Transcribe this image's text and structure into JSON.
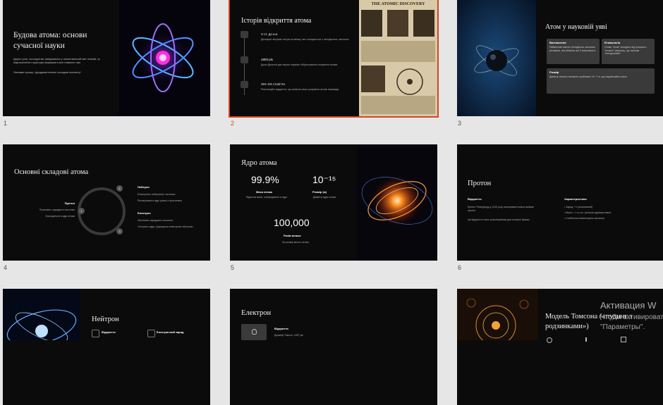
{
  "slides": [
    {
      "number": "1",
      "title": "Будова атома: основи сучасної науки",
      "body1": "Дорогі учні, сьогодні ми зануримося у захоплюючий світ атомів, ці мікроскопічні структури формують все навколо нас.",
      "body2": "Ласкаво прошу: фундаментальні складові всесвіту!"
    },
    {
      "number": "2",
      "title": "Історія відкриття атома",
      "poster_title": "THE ATOMIC DISCOVERY",
      "items": [
        {
          "label": "V ст. до н.е.",
          "text": "Демокрит висуває теорію атомізму: все складається з неподільних частинок."
        },
        {
          "label": "1803 рік",
          "text": "Джон Дальтон дає перше наукове обґрунтування існування атомів."
        },
        {
          "label": "XIX–XX століття",
          "text": "Революційні відкриття, що змінили наше розуміння атома назавжди."
        }
      ]
    },
    {
      "number": "3",
      "title": "Атом у науковій уяві",
      "cards": [
        {
          "h": "Визначення",
          "t": "Найменша хімічно неподільна частинка речовини, яка зберігає всі її властивості."
        },
        {
          "h": "Етимологія",
          "t": "Слово \"атом\" походить від грецького \"атомос\" (atomos), що означає \"неподільний\"."
        },
        {
          "h": "Розмір",
          "t": "Діаметр атома становить приблизно 10⁻¹⁰ м, що надзвичайно мало."
        }
      ]
    },
    {
      "number": "4",
      "title": "Основні складові атома",
      "labels": [
        {
          "h": "Нейтрон",
          "t1": "Електрично нейтральні частинки",
          "t2": "Розташовані в ядрі разом з протонами"
        },
        {
          "h": "Протон",
          "t1": "Позитивно заряджені частинки",
          "t2": "Знаходяться в ядрі атома"
        },
        {
          "h": "Електрон",
          "t1": "Негативно заряджені частинки",
          "t2": "Оточують ядро, формуючи електронні оболонки"
        }
      ],
      "markers": [
        "1",
        "2",
        "3"
      ]
    },
    {
      "number": "5",
      "title": "Ядро атома",
      "stats": [
        {
          "value": "99.9%",
          "label": "Маса атома",
          "desc": "Відсоток маси, зосередженої в ядрі"
        },
        {
          "value": "10⁻¹⁵",
          "label": "Розмір (м)",
          "desc": "Діаметр ядра атома"
        },
        {
          "value": "100,000",
          "label": "Разів менше",
          "desc": "За розмір всього атома"
        }
      ]
    },
    {
      "number": "6",
      "title": "Протон",
      "left_h": "Відкриття",
      "left_t1": "Ернест Резерфорд у 1919 році експериментально виявив протон.",
      "left_t2": "Це відкриття стало революційним для атомної фізики.",
      "right_h": "Характеристики",
      "bullets": [
        "Заряд: +1 (позитивний)",
        "Маса: ≈ 1 а.о.м. (атомна одиниця маси)",
        "Стабільна елементарна частинка"
      ]
    },
    {
      "title": "Нейтрон",
      "f1": "Відкриття",
      "f2": "Електричний заряд"
    },
    {
      "title": "Електрон",
      "f1": "Відкриття",
      "f1_t": "Джозеф Томсон, 1897 рік"
    },
    {
      "title": "Модель Томсона («пудинг з родзинками»)"
    }
  ],
  "activation": {
    "line1": "Активация W",
    "line2": "Чтобы активировать",
    "line3": "\"Параметры\"."
  },
  "colors": {
    "selection": "#d24726",
    "canvas": "#e6e6e6",
    "slide_bg": "#0b0b0b"
  }
}
